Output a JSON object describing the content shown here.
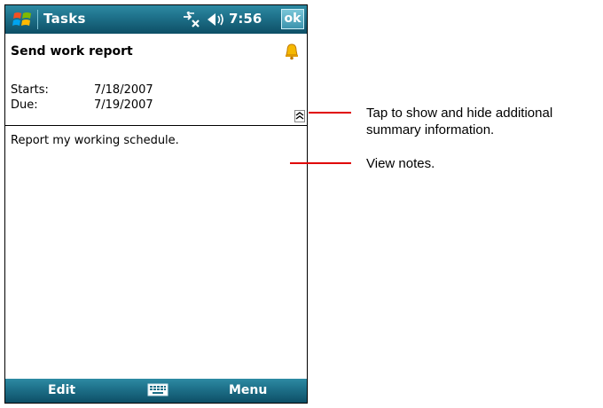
{
  "titlebar": {
    "title": "Tasks",
    "time": "7:56",
    "ok_label": "ok"
  },
  "task": {
    "subject": "Send work report",
    "starts_label": "Starts:",
    "starts_value": "7/18/2007",
    "due_label": "Due:",
    "due_value": "7/19/2007",
    "notes": "Report my working schedule."
  },
  "softkeys": {
    "left": "Edit",
    "right": "Menu"
  },
  "callouts": {
    "summary": [
      "Tap to show and hide additional",
      "summary information."
    ],
    "notes": "View notes."
  },
  "colors": {
    "bar": "#1d6f88",
    "callout_line": "#e00000"
  },
  "icons": [
    "windows-start-icon",
    "connectivity-icon",
    "volume-icon",
    "bell-reminder-icon",
    "collapse-summary-icon",
    "keyboard-icon"
  ]
}
